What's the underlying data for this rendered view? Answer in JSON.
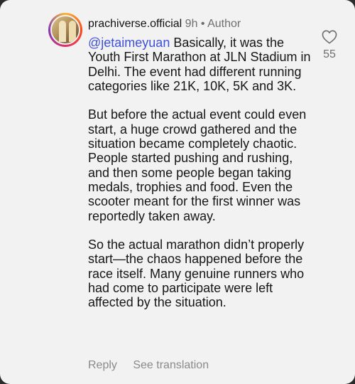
{
  "comment": {
    "username": "prachiverse.official",
    "time": "9h",
    "separator": "•",
    "role": "Author",
    "mention": "@jetaimeyuan",
    "para1_rest": " Basically, it was the Youth First Marathon at JLN Stadium in Delhi. The event had different running categories like 21K, 10K, 5K and 3K.",
    "para2": "But before the actual event could even start, a huge crowd gathered and the situation became completely chaotic. People started pushing and rushing, and then some people began taking medals, trophies and food. Even the scooter meant for the first winner was reportedly taken away.",
    "para3": "So the actual marathon didn’t properly start—the chaos happened before the race itself. Many genuine runners who had come to participate were left affected by the situation.",
    "like_count": "55",
    "like_icon": "heart-outline-icon"
  },
  "actions": {
    "reply_label": "Reply",
    "translate_label": "See translation"
  },
  "colors": {
    "mention": "#3f51d9",
    "meta": "#6f6f6f",
    "background": "#f2f2f2"
  }
}
